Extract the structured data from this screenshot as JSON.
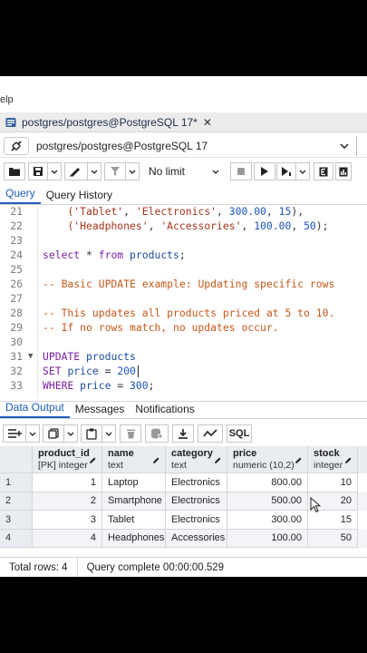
{
  "menu": {
    "help_fragment": "elp"
  },
  "tab": {
    "title": "postgres/postgres@PostgreSQL 17*",
    "close": "✕"
  },
  "connection": {
    "label": "postgres/postgres@PostgreSQL 17"
  },
  "toolbar": {
    "limit_label": "No limit"
  },
  "editor_tabs": [
    "Query",
    "Query History"
  ],
  "editor": {
    "lines": [
      {
        "n": "21",
        "parts": [
          [
            "plain",
            "    "
          ],
          [
            "str",
            "('Tablet'"
          ],
          [
            "plain",
            ", "
          ],
          [
            "str",
            "'Electronics'"
          ],
          [
            "plain",
            ", "
          ],
          [
            "num",
            "300.00"
          ],
          [
            "plain",
            ", "
          ],
          [
            "num",
            "15"
          ],
          [
            "plain",
            "),"
          ]
        ]
      },
      {
        "n": "22",
        "parts": [
          [
            "plain",
            "    "
          ],
          [
            "str",
            "('Headphones'"
          ],
          [
            "plain",
            ", "
          ],
          [
            "str",
            "'Accessories'"
          ],
          [
            "plain",
            ", "
          ],
          [
            "num",
            "100.00"
          ],
          [
            "plain",
            ", "
          ],
          [
            "num",
            "50"
          ],
          [
            "plain",
            ");"
          ]
        ]
      },
      {
        "n": "23",
        "parts": []
      },
      {
        "n": "24",
        "parts": [
          [
            "kw",
            "select"
          ],
          [
            "plain",
            " * "
          ],
          [
            "kw",
            "from"
          ],
          [
            "plain",
            " "
          ],
          [
            "tbl",
            "products"
          ],
          [
            "plain",
            ";"
          ]
        ]
      },
      {
        "n": "25",
        "parts": []
      },
      {
        "n": "26",
        "parts": [
          [
            "cmt",
            "-- Basic UPDATE example: Updating specific rows"
          ]
        ]
      },
      {
        "n": "27",
        "parts": []
      },
      {
        "n": "28",
        "parts": [
          [
            "cmt",
            "-- This updates all products priced at 5 to 10."
          ]
        ]
      },
      {
        "n": "29",
        "parts": [
          [
            "cmt",
            "-- If no rows match, no updates occur."
          ]
        ]
      },
      {
        "n": "30",
        "parts": []
      },
      {
        "n": "31",
        "fold": true,
        "parts": [
          [
            "kw",
            "UPDATE"
          ],
          [
            "plain",
            " "
          ],
          [
            "tbl",
            "products"
          ]
        ]
      },
      {
        "n": "32",
        "caret": true,
        "parts": [
          [
            "kw",
            "SET"
          ],
          [
            "plain",
            " "
          ],
          [
            "tbl",
            "price"
          ],
          [
            "plain",
            " = "
          ],
          [
            "num",
            "200"
          ]
        ]
      },
      {
        "n": "33",
        "parts": [
          [
            "kw",
            "WHERE"
          ],
          [
            "plain",
            " "
          ],
          [
            "tbl",
            "price"
          ],
          [
            "plain",
            " = "
          ],
          [
            "num",
            "300"
          ],
          [
            "plain",
            ";"
          ]
        ]
      }
    ]
  },
  "result_tabs": [
    "Data Output",
    "Messages",
    "Notifications"
  ],
  "results": {
    "sql_label": "SQL",
    "columns": [
      {
        "name": "product_id",
        "type": "[PK] integer"
      },
      {
        "name": "name",
        "type": "text"
      },
      {
        "name": "category",
        "type": "text"
      },
      {
        "name": "price",
        "type": "numeric (10,2)"
      },
      {
        "name": "stock",
        "type": "integer"
      }
    ],
    "rows": [
      {
        "n": "1",
        "cells": [
          "1",
          "Laptop",
          "Electronics",
          "800.00",
          "10"
        ]
      },
      {
        "n": "2",
        "cells": [
          "2",
          "Smartphone",
          "Electronics",
          "500.00",
          "20"
        ]
      },
      {
        "n": "3",
        "cells": [
          "3",
          "Tablet",
          "Electronics",
          "300.00",
          "15"
        ]
      },
      {
        "n": "4",
        "cells": [
          "4",
          "Headphones",
          "Accessories",
          "100.00",
          "50"
        ]
      }
    ]
  },
  "status": {
    "total_rows": "Total rows: 4",
    "query_time": "Query complete 00:00:00.529"
  },
  "colors": {
    "accent": "#1f5cb8",
    "keyword": "#7c1fa6",
    "string": "#a6341d",
    "comment": "#c3581a"
  }
}
